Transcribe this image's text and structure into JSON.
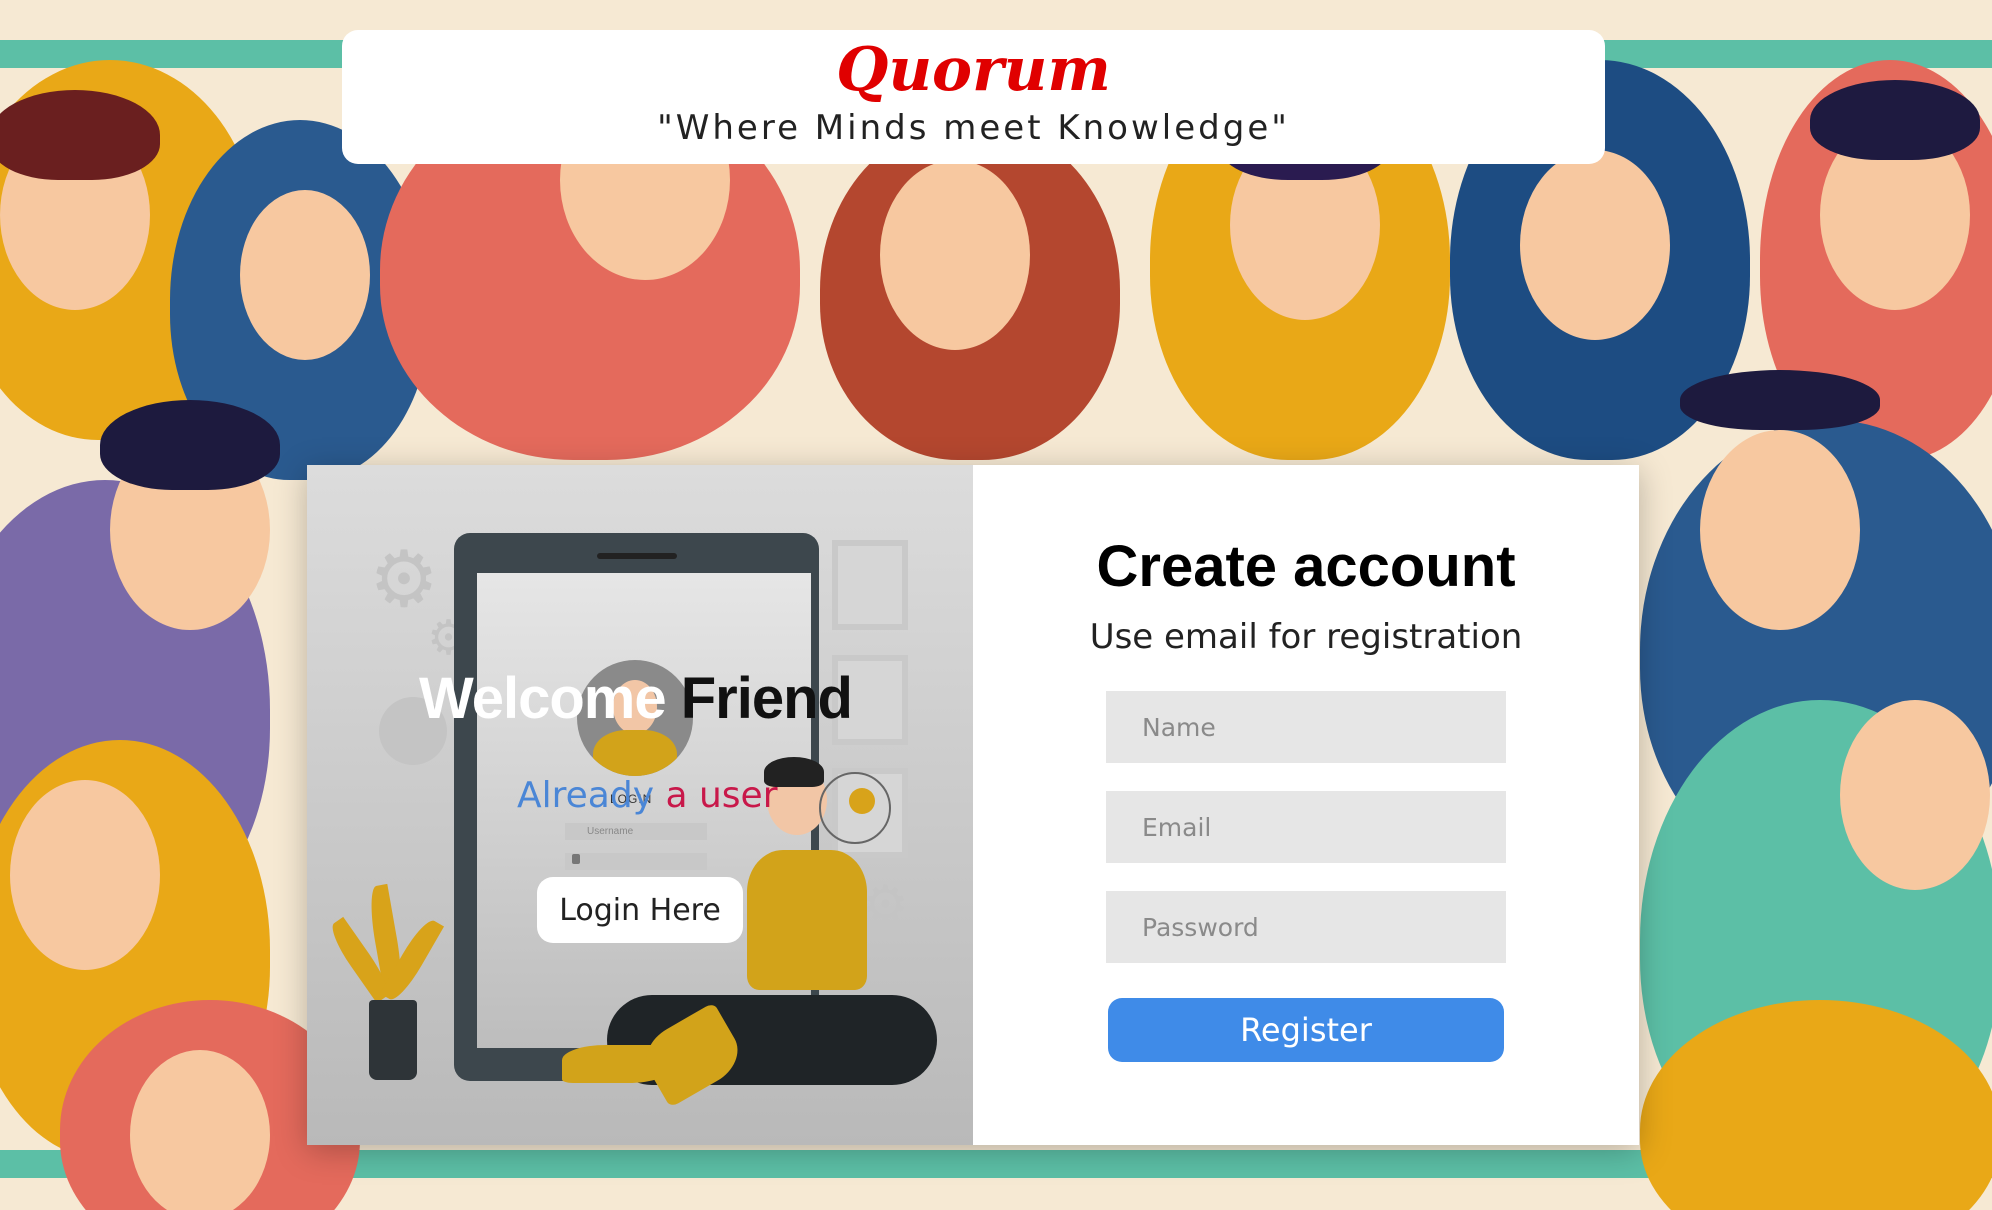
{
  "header": {
    "brand": "Quorum",
    "tagline": "\"Where Minds meet Knowledge\""
  },
  "welcome_panel": {
    "title_part1": "Welcome",
    "title_part2": "Friend",
    "prompt_part1": "Already",
    "prompt_part2": "a user",
    "illustration_login_label": "LOGIN",
    "illustration_username_placeholder": "Username",
    "login_button_label": "Login Here"
  },
  "register_panel": {
    "title": "Create account",
    "subtitle": "Use email for registration",
    "name_placeholder": "Name",
    "email_placeholder": "Email",
    "password_placeholder": "Password",
    "register_button_label": "Register"
  },
  "colors": {
    "brand": "#e00000",
    "register_button": "#3f8be8",
    "prompt_blue": "#4a86d6",
    "prompt_red": "#c8184a"
  },
  "icons": [
    "gear-icon",
    "user-icon",
    "lock-icon",
    "key-icon",
    "plant-icon"
  ]
}
